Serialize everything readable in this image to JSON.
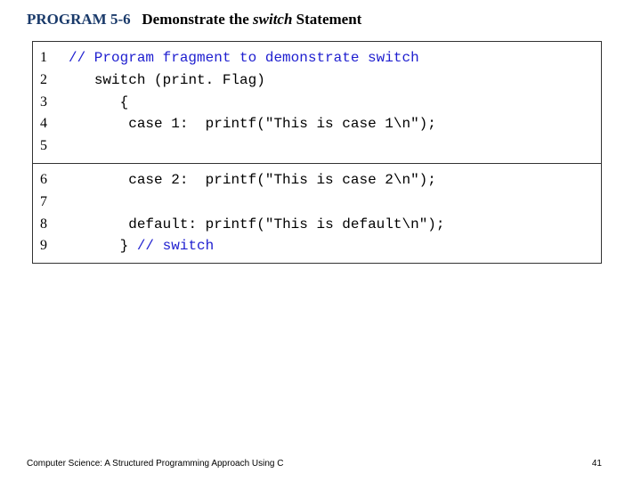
{
  "header": {
    "program_label": "PROGRAM 5-6",
    "title_before": "Demonstrate the ",
    "switch_word": "switch",
    "title_after": " Statement"
  },
  "code": {
    "block1": [
      {
        "n": "1",
        "html": "<span class='comment'>// Program fragment to demonstrate switch</span>"
      },
      {
        "n": "2",
        "html": "   <span class='kw'>switch</span> <span class='paren'>(</span><span class='ftext'>print. Flag</span><span class='paren'>)</span>"
      },
      {
        "n": "3",
        "html": "      <span class='punct'>{</span>"
      },
      {
        "n": "4",
        "html": "       <span class='kw'>case</span> 1:  printf(<span class='str'>\"This is case 1\\n\"</span>);"
      },
      {
        "n": "5",
        "html": ""
      }
    ],
    "block2": [
      {
        "n": "6",
        "html": "       <span class='kw'>case</span> 2:  printf(<span class='str'>\"This is case 2\\n\"</span>);"
      },
      {
        "n": "7",
        "html": ""
      },
      {
        "n": "8",
        "html": "       <span class='kw'>default</span>: printf(<span class='str'>\"This is default\\n\"</span>);"
      },
      {
        "n": "9",
        "html": "      <span class='punct'>}</span> <span class='comment'>// switch</span>"
      }
    ]
  },
  "footer": {
    "left": "Computer Science: A Structured Programming Approach Using C",
    "page": "41"
  }
}
